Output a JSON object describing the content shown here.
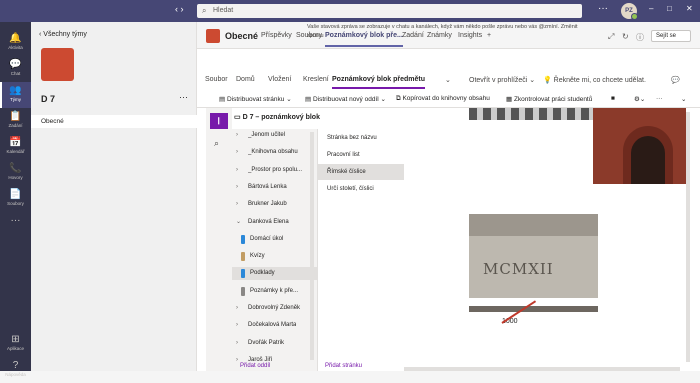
{
  "search": {
    "placeholder": "Hledat"
  },
  "user": {
    "initials": "PZ"
  },
  "rail": [
    {
      "label": "Aktivita",
      "icon": "bell-icon"
    },
    {
      "label": "Chat",
      "icon": "chat-icon"
    },
    {
      "label": "Týmy",
      "icon": "teams-icon"
    },
    {
      "label": "Zadání",
      "icon": "assignments-icon"
    },
    {
      "label": "Kalendář",
      "icon": "calendar-icon"
    },
    {
      "label": "Hovory",
      "icon": "phone-icon"
    },
    {
      "label": "Soubory",
      "icon": "files-icon"
    },
    {
      "label": "Aplikace",
      "icon": "apps-icon"
    },
    {
      "label": "Nápověda",
      "icon": "help-icon"
    }
  ],
  "team": {
    "back": "Všechny týmy",
    "name": "D 7",
    "channel": "Obecné"
  },
  "channel": {
    "title": "Obecné",
    "tabs": [
      "Příspěvky",
      "Soubory",
      "Poznámkový blok pře...",
      "Zadání",
      "Známky",
      "Insights"
    ],
    "banner": "Vaše stavová zpráva se zobrazuje v chatu a kanálech, když vám někdo pošle zprávu nebo vás @zmíní. Změnit zprávu",
    "meet": "Sejít se"
  },
  "ribbon": {
    "tabs": [
      "Soubor",
      "Domů",
      "Vložení",
      "Kreslení",
      "Poznámkový blok předmětu",
      "Otevřít v prohlížeči"
    ],
    "tell": "Řekněte mi, co chcete udělat."
  },
  "tools": [
    "Distribuovat stránku",
    "Distribuovat nový oddíl",
    "Kopírovat do knihovny obsahu",
    "Zkontrolovat práci studentů"
  ],
  "notebook": {
    "title": "D 7 – poznámkový blok",
    "add_section": "Přidat oddíl",
    "add_page": "Přidat stránku"
  },
  "sections": [
    {
      "name": "_Jenom učitel",
      "car": ">"
    },
    {
      "name": "_Knihovna obsahu",
      "car": ">"
    },
    {
      "name": "_Prostor pro spolu...",
      "car": ">"
    },
    {
      "name": "Bártová Lenka",
      "car": ">"
    },
    {
      "name": "Brukner Jakub",
      "car": ">"
    },
    {
      "name": "Danková Elena",
      "car": "v"
    },
    {
      "name": "Domácí úkol",
      "sub": true,
      "color": "#2b88d8"
    },
    {
      "name": "Kvízy",
      "sub": true,
      "color": "#c29d63"
    },
    {
      "name": "Podklady",
      "sub": true,
      "color": "#2b88d8",
      "sel": true
    },
    {
      "name": "Poznámky k pře...",
      "sub": true,
      "color": "#8a8886"
    },
    {
      "name": "Dobrovolný Zdeněk",
      "car": ">"
    },
    {
      "name": "Dočekalová Marta",
      "car": ">"
    },
    {
      "name": "Dvořák Patrik",
      "car": ">"
    },
    {
      "name": "Jaroš Jiří",
      "car": ">"
    }
  ],
  "pages": [
    "Stránka bez názvu",
    "Pracovní list",
    "Římské číslice",
    "Určí století, číslici"
  ],
  "canvas": {
    "roman": "MCMXII",
    "number": "1000"
  }
}
